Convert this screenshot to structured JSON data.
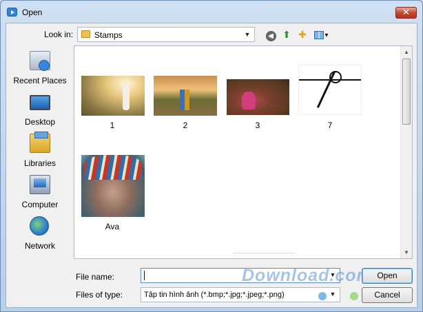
{
  "window": {
    "title": "Open",
    "close_label": "✕"
  },
  "toolbar": {
    "look_in_label": "Look in:",
    "look_in_value": "Stamps"
  },
  "places": [
    {
      "label": "Recent Places",
      "icon": "recent-places-icon"
    },
    {
      "label": "Desktop",
      "icon": "desktop-icon"
    },
    {
      "label": "Libraries",
      "icon": "libraries-icon"
    },
    {
      "label": "Computer",
      "icon": "computer-icon"
    },
    {
      "label": "Network",
      "icon": "network-icon"
    }
  ],
  "files": [
    {
      "name": "1"
    },
    {
      "name": "2"
    },
    {
      "name": "3"
    },
    {
      "name": "7"
    },
    {
      "name": "Ava"
    }
  ],
  "bottom": {
    "file_name_label": "File name:",
    "file_name_value": "",
    "files_of_type_label": "Files of type:",
    "files_of_type_value": "Tập tin hình ảnh (*.bmp;*.jpg;*.jpeg;*.png)",
    "open_label": "Open",
    "cancel_label": "Cancel"
  },
  "watermark": "Download.com.vn",
  "colors": {
    "accent": "#3c7fb1",
    "close": "#c4432e"
  }
}
